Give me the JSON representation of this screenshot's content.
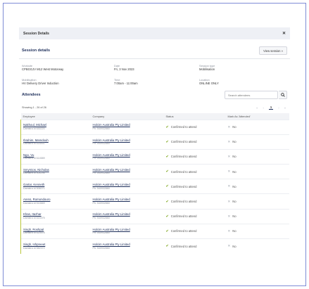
{
  "modal": {
    "title": "Session Details",
    "close_icon": "close-icon"
  },
  "session": {
    "heading": "Session details",
    "view_button": "View session »",
    "fields": [
      {
        "label": "Worksite",
        "value": "CPBGGJV M12 West Motorway"
      },
      {
        "label": "Date",
        "value": "Fri, 3 Nov 2023"
      },
      {
        "label": "Session type",
        "value": "Mobilisation"
      },
      {
        "label": "Mobilisation",
        "value": "HV Delivery Driver Induction"
      },
      {
        "label": "Time",
        "value": "7:00am - 11:00am"
      },
      {
        "label": "Location",
        "value": "ONLINE ONLY"
      }
    ]
  },
  "attendees": {
    "heading": "Attendees",
    "search_placeholder": "Search attendees",
    "showing": "Showing 1 - 26 of 26",
    "pager": {
      "first": "«",
      "prev": "‹",
      "current": "1",
      "next": "›",
      "last": "»"
    },
    "columns": [
      "Employee",
      "Company",
      "Status",
      "Mark As 'Attended'"
    ],
    "rows": [
      {
        "name": "Nakhoul, Michael",
        "sub": "Damstra Id 630220",
        "company": "Holcim Australia Pty Limited",
        "company_sub": "Ph: 540932860",
        "status": "Confirmed to attend",
        "mark": "No"
      },
      {
        "name": "Ibrahim, Mamdouh",
        "sub": "Damstra Id 618451",
        "company": "Holcim Australia Pty Limited",
        "company_sub": "Ph: 540932860",
        "status": "Confirmed to attend",
        "mark": "No"
      },
      {
        "name": "Ngo, Vu",
        "sub": "Damstra Id 614589",
        "company": "Holcim Australia Pty Limited",
        "company_sub": "Ph: 540932860",
        "status": "Confirmed to attend",
        "mark": "No"
      },
      {
        "name": "Smyrnios, Nicholas",
        "sub": "Damstra Id 404298",
        "company": "Holcim Australia Pty Limited",
        "company_sub": "Ph: 540932860",
        "status": "Confirmed to attend",
        "mark": "No"
      },
      {
        "name": "Gartar, Kenneth",
        "sub": "Damstra Id 506071",
        "company": "Holcim Australia Pty Limited",
        "company_sub": "Ph: 540932860",
        "status": "Confirmed to attend",
        "mark": "No"
      },
      {
        "name": "Arens, Romondouro",
        "sub": "Damstra Id 514669",
        "company": "Holcim Australia Pty Limited",
        "company_sub": "Ph: 540932860",
        "status": "Confirmed to attend",
        "mark": "No"
      },
      {
        "name": "Khan, Itazhar",
        "sub": "Damstra Id 615375",
        "company": "Holcim Australia Pty Limited",
        "company_sub": "Ph: 540932860",
        "status": "Confirmed to attend",
        "mark": "No"
      },
      {
        "name": "Singh, Roshpal",
        "sub": "Damstra Id 614578",
        "company": "Holcim Australia Pty Limited",
        "company_sub": "Ph: 540932860",
        "status": "Confirmed to attend",
        "mark": "No"
      },
      {
        "name": "Singh, Ishpreeet",
        "sub": "Damstra Id 582372",
        "company": "Holcim Australia Pty Limited",
        "company_sub": "Ph: 540932860",
        "status": "Confirmed to attend",
        "mark": "No"
      }
    ]
  },
  "colors": {
    "frame_border": "#7e8cd6",
    "accent_navy": "#1e2f5b",
    "row_marker": "#b9c63a",
    "check_green": "#8fb23a"
  }
}
